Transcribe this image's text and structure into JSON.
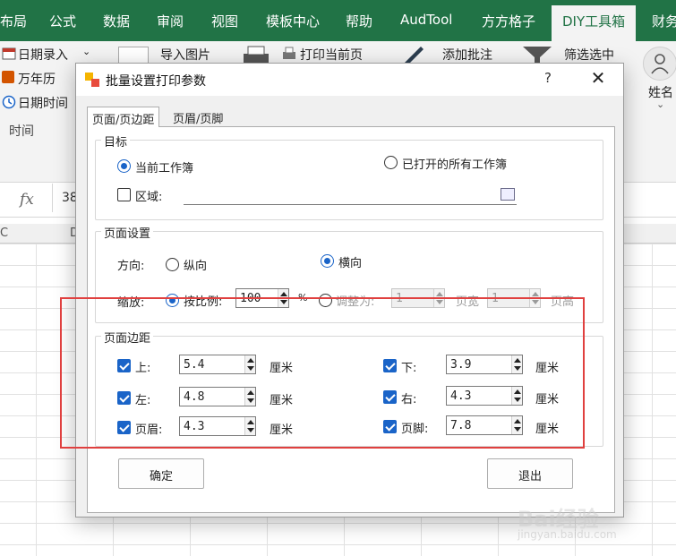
{
  "excel": {
    "tabs": [
      "布局",
      "公式",
      "数据",
      "审阅",
      "视图",
      "模板中心",
      "帮助",
      "AudTool",
      "方方格子",
      "DIY工具箱",
      "财务"
    ],
    "active_tab_index": 9,
    "ribbon_items": {
      "date_entry": "日期录入",
      "perpetual_calendar": "万年历",
      "date_time": "日期时间",
      "time_group": "时间",
      "import_image": "导入图片",
      "print_current_page": "打印当前页",
      "add_comment": "添加批注",
      "filter_selected": "筛选选中",
      "name": "姓名"
    },
    "cell_ref": "38",
    "column_headers": [
      "C",
      "D"
    ]
  },
  "dialog": {
    "title": "批量设置打印参数",
    "help": "?",
    "close": "✕",
    "tabs": [
      "页面/页边距",
      "页眉/页脚"
    ],
    "target": {
      "legend": "目标",
      "current_workbook": "当前工作簿",
      "all_open_workbooks": "已打开的所有工作簿",
      "range_label": "区域:"
    },
    "page_setup": {
      "legend": "页面设置",
      "orientation_label": "方向:",
      "portrait": "纵向",
      "landscape": "横向",
      "scale_label": "缩放:",
      "by_ratio": "按比例:",
      "ratio_value": "100",
      "percent": "%",
      "fit_to": "调整为:",
      "pages_wide_value": "1",
      "pages_wide": "页宽",
      "pages_tall_value": "1",
      "pages_tall": "页高"
    },
    "margins": {
      "legend": "页面边距",
      "unit": "厘米",
      "items": [
        {
          "label": "上:",
          "value": "5.4"
        },
        {
          "label": "下:",
          "value": "3.9"
        },
        {
          "label": "左:",
          "value": "4.8"
        },
        {
          "label": "右:",
          "value": "4.3"
        },
        {
          "label": "页眉:",
          "value": "4.3"
        },
        {
          "label": "页脚:",
          "value": "7.8"
        }
      ]
    },
    "ok_button": "确定",
    "exit_button": "退出"
  },
  "watermark": {
    "text": "Bai经验",
    "sub": "jingyan.baidu.com"
  },
  "colors": {
    "excel_green": "#217346",
    "accent_blue": "#1a64c8",
    "highlight_red": "#e0403f"
  }
}
